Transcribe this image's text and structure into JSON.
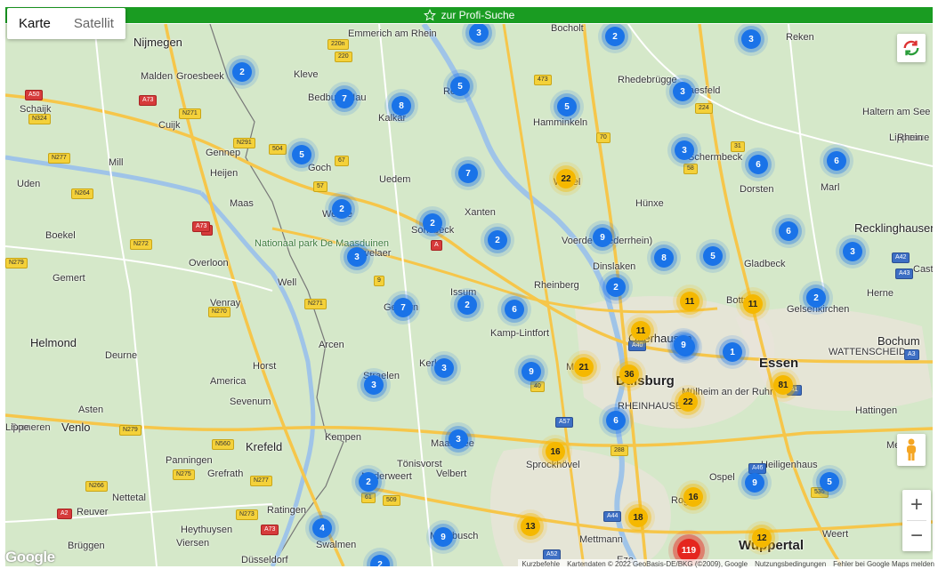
{
  "topbar": {
    "label": "zur Profi-Suche",
    "icon": "star-icon",
    "color": "#1a9c22"
  },
  "map_type": {
    "options": [
      "Karte",
      "Satellit"
    ],
    "selected": "Karte"
  },
  "controls": {
    "zoom_in": "+",
    "zoom_out": "−"
  },
  "logo": "Google",
  "attribution": {
    "shortcuts": "Kurzbefehle",
    "data": "Kartendaten © 2022 GeoBasis-DE/BKG (©2009), Google",
    "terms": "Nutzungsbedingungen",
    "report": "Fehler bei Google Maps melden"
  },
  "places": [
    {
      "label": "Nijmegen",
      "cls": "mid"
    },
    {
      "label": "Malden"
    },
    {
      "label": "Groesbeek"
    },
    {
      "label": "Kleve"
    },
    {
      "label": "Emmerich am Rhein"
    },
    {
      "label": "Bocholt"
    },
    {
      "label": "Rhedebrügge"
    },
    {
      "label": "Reken"
    },
    {
      "label": "Schaijk"
    },
    {
      "label": "Cuijk"
    },
    {
      "label": "Bedburg-Hau"
    },
    {
      "label": "Kalkar"
    },
    {
      "label": "Rees"
    },
    {
      "label": "Hamminkeln"
    },
    {
      "label": "Raesfeld"
    },
    {
      "label": "Haltern am See"
    },
    {
      "label": "Lippeaue"
    },
    {
      "label": "Mill"
    },
    {
      "label": "Gennep"
    },
    {
      "label": "Heijen"
    },
    {
      "label": "Goch"
    },
    {
      "label": "Uedem"
    },
    {
      "label": "Schermbeck"
    },
    {
      "label": "Dorsten"
    },
    {
      "label": "Marl"
    },
    {
      "label": "Uden"
    },
    {
      "label": "Maas"
    },
    {
      "label": "Xanten"
    },
    {
      "label": "Wesel"
    },
    {
      "label": "Hünxe"
    },
    {
      "label": "Weeze"
    },
    {
      "label": "Boekel"
    },
    {
      "label": "Sonsbeck"
    },
    {
      "label": "Voerde (Niederrhein)"
    },
    {
      "label": "Recklinghausen",
      "cls": "mid"
    },
    {
      "label": "Nationaal park De Maasduinen",
      "cls": "park"
    },
    {
      "label": "Kevelaer"
    },
    {
      "label": "Dinslaken"
    },
    {
      "label": "Gladbeck"
    },
    {
      "label": "Gemert"
    },
    {
      "label": "Overloon"
    },
    {
      "label": "Well"
    },
    {
      "label": "Issum"
    },
    {
      "label": "Rheinberg"
    },
    {
      "label": "Bottrop"
    },
    {
      "label": "Gelsenkirchen"
    },
    {
      "label": "Herne"
    },
    {
      "label": "Castrop-Rauxel"
    },
    {
      "label": "Venray"
    },
    {
      "label": "Geldern"
    },
    {
      "label": "Kamp-Lintfort"
    },
    {
      "label": "Oberhausen",
      "cls": "mid"
    },
    {
      "label": "Helmond",
      "cls": "mid"
    },
    {
      "label": "Deurne"
    },
    {
      "label": "Arcen"
    },
    {
      "label": "Bochum",
      "cls": "mid"
    },
    {
      "label": "Horst"
    },
    {
      "label": "Kerken"
    },
    {
      "label": "Moers"
    },
    {
      "label": "Essen",
      "cls": "big"
    },
    {
      "label": "WATTENSCHEID"
    },
    {
      "label": "America"
    },
    {
      "label": "Straelen"
    },
    {
      "label": "Duisburg",
      "cls": "big"
    },
    {
      "label": "Mülheim an der Ruhr"
    },
    {
      "label": "Asten"
    },
    {
      "label": "Sevenum"
    },
    {
      "label": "RHEINHAUSEN"
    },
    {
      "label": "Hattingen"
    },
    {
      "label": "Someren"
    },
    {
      "label": "Venlo",
      "cls": "mid"
    },
    {
      "label": "Kempen"
    },
    {
      "label": "Maasbree"
    },
    {
      "label": "Krefeld",
      "cls": "mid"
    },
    {
      "label": "Sprockhövel"
    },
    {
      "label": "Meijel"
    },
    {
      "label": "Panningen"
    },
    {
      "label": "Grefrath"
    },
    {
      "label": "Tönisvorst"
    },
    {
      "label": "Velbert"
    },
    {
      "label": "Heiligenhaus"
    },
    {
      "label": "Ospel"
    },
    {
      "label": "Nettetal"
    },
    {
      "label": "Nederweert"
    },
    {
      "label": "Reuver"
    },
    {
      "label": "Ratingen"
    },
    {
      "label": "Roggel"
    },
    {
      "label": "Heythuysen"
    },
    {
      "label": "Viersen"
    },
    {
      "label": "Meerbusch"
    },
    {
      "label": "Mettmann"
    },
    {
      "label": "Wuppertal",
      "cls": "big"
    },
    {
      "label": "Weert"
    },
    {
      "label": "Brüggen"
    },
    {
      "label": "Swalmen"
    },
    {
      "label": "Düsseldorf"
    },
    {
      "label": "Eze"
    },
    {
      "label": "Lippe"
    },
    {
      "label": "Rhein"
    }
  ],
  "shields": [
    "220n",
    "220",
    "A50",
    "N324",
    "A73",
    "N271",
    "N291",
    "504",
    "67",
    "473",
    "70",
    "31",
    "224",
    "58",
    "A",
    "N277",
    "N264",
    "57",
    "A73",
    "N272",
    "N279",
    "N270",
    "N271",
    "9",
    "A",
    "N279",
    "N560",
    "N275",
    "N277",
    "N266",
    "A2",
    "N273",
    "A73",
    "61",
    "509",
    "A57",
    "A40",
    "A42",
    "A43",
    "A3",
    "A52",
    "A44",
    "A1",
    "A46",
    "288",
    "535",
    "40"
  ],
  "clusters": [
    {
      "n": "2",
      "c": "blue"
    },
    {
      "n": "3",
      "c": "blue"
    },
    {
      "n": "2",
      "c": "blue"
    },
    {
      "n": "3",
      "c": "blue"
    },
    {
      "n": "7",
      "c": "blue"
    },
    {
      "n": "8",
      "c": "blue"
    },
    {
      "n": "5",
      "c": "blue"
    },
    {
      "n": "5",
      "c": "blue"
    },
    {
      "n": "3",
      "c": "blue"
    },
    {
      "n": "5",
      "c": "blue"
    },
    {
      "n": "3",
      "c": "blue"
    },
    {
      "n": "6",
      "c": "blue"
    },
    {
      "n": "6",
      "c": "blue"
    },
    {
      "n": "7",
      "c": "blue"
    },
    {
      "n": "22",
      "c": "yellow"
    },
    {
      "n": "2",
      "c": "blue"
    },
    {
      "n": "2",
      "c": "blue"
    },
    {
      "n": "2",
      "c": "blue"
    },
    {
      "n": "9",
      "c": "blue"
    },
    {
      "n": "6",
      "c": "blue"
    },
    {
      "n": "3",
      "c": "blue"
    },
    {
      "n": "8",
      "c": "blue"
    },
    {
      "n": "5",
      "c": "blue"
    },
    {
      "n": "3",
      "c": "blue"
    },
    {
      "n": "2",
      "c": "blue"
    },
    {
      "n": "2",
      "c": "blue"
    },
    {
      "n": "7",
      "c": "blue"
    },
    {
      "n": "2",
      "c": "blue"
    },
    {
      "n": "6",
      "c": "blue"
    },
    {
      "n": "11",
      "c": "yellow"
    },
    {
      "n": "11",
      "c": "yellow"
    },
    {
      "n": "2",
      "c": "blue"
    },
    {
      "n": "11",
      "c": "yellow"
    },
    {
      "n": "9",
      "c": "blue"
    },
    {
      "n": "1",
      "c": "blue"
    },
    {
      "n": "3",
      "c": "blue"
    },
    {
      "n": "9",
      "c": "blue"
    },
    {
      "n": "21",
      "c": "yellow"
    },
    {
      "n": "36",
      "c": "yellow"
    },
    {
      "n": "3",
      "c": "blue"
    },
    {
      "n": "22",
      "c": "yellow"
    },
    {
      "n": "81",
      "c": "yellow"
    },
    {
      "n": "6",
      "c": "blue"
    },
    {
      "n": "3",
      "c": "blue"
    },
    {
      "n": "16",
      "c": "yellow"
    },
    {
      "n": "2",
      "c": "blue"
    },
    {
      "n": "16",
      "c": "yellow"
    },
    {
      "n": "9",
      "c": "blue"
    },
    {
      "n": "5",
      "c": "blue"
    },
    {
      "n": "4",
      "c": "blue"
    },
    {
      "n": "9",
      "c": "blue"
    },
    {
      "n": "13",
      "c": "yellow"
    },
    {
      "n": "18",
      "c": "yellow"
    },
    {
      "n": "119",
      "c": "red"
    },
    {
      "n": "12",
      "c": "yellow"
    },
    {
      "n": "2",
      "c": "blue"
    }
  ]
}
